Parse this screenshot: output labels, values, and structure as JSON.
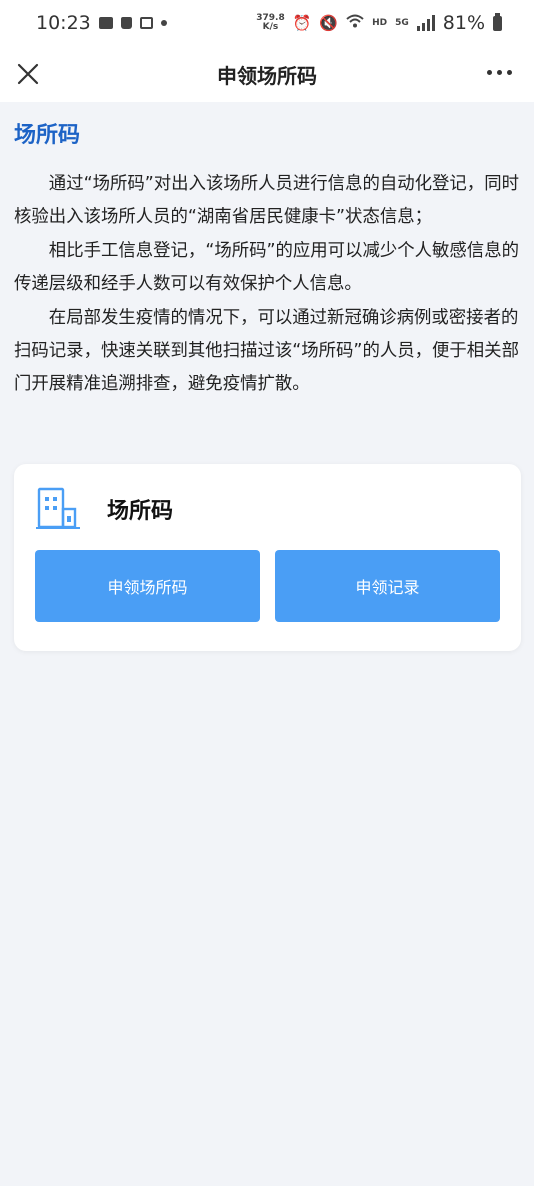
{
  "status_bar": {
    "time": "10:23",
    "net_speed_value": "379.8",
    "net_speed_unit": "K/s",
    "network_label": "HD",
    "network_type": "5G",
    "battery": "81%"
  },
  "nav": {
    "title": "申领场所码",
    "close_icon": "close-icon",
    "more_icon": "more-dots-icon"
  },
  "main": {
    "section_title": "场所码",
    "paragraphs": [
      "通过“场所码”对出入该场所人员进行信息的自动化登记，同时核验出入该场所人员的“湖南省居民健康卡”状态信息；",
      "相比手工信息登记，“场所码”的应用可以减少个人敏感信息的传递层级和经手人数可以有效保护个人信息。",
      "在局部发生疫情的情况下，可以通过新冠确诊病例或密接者的扫码记录，快速关联到其他扫描过该“场所码”的人员，便于相关部门开展精准追溯排查，避免疫情扩散。"
    ]
  },
  "card": {
    "icon": "building-icon",
    "title": "场所码",
    "buttons": {
      "apply_label": "申领场所码",
      "record_label": "申领记录"
    }
  },
  "colors": {
    "accent": "#1d63c6",
    "button": "#4a9ef5",
    "background": "#f2f4f8"
  }
}
